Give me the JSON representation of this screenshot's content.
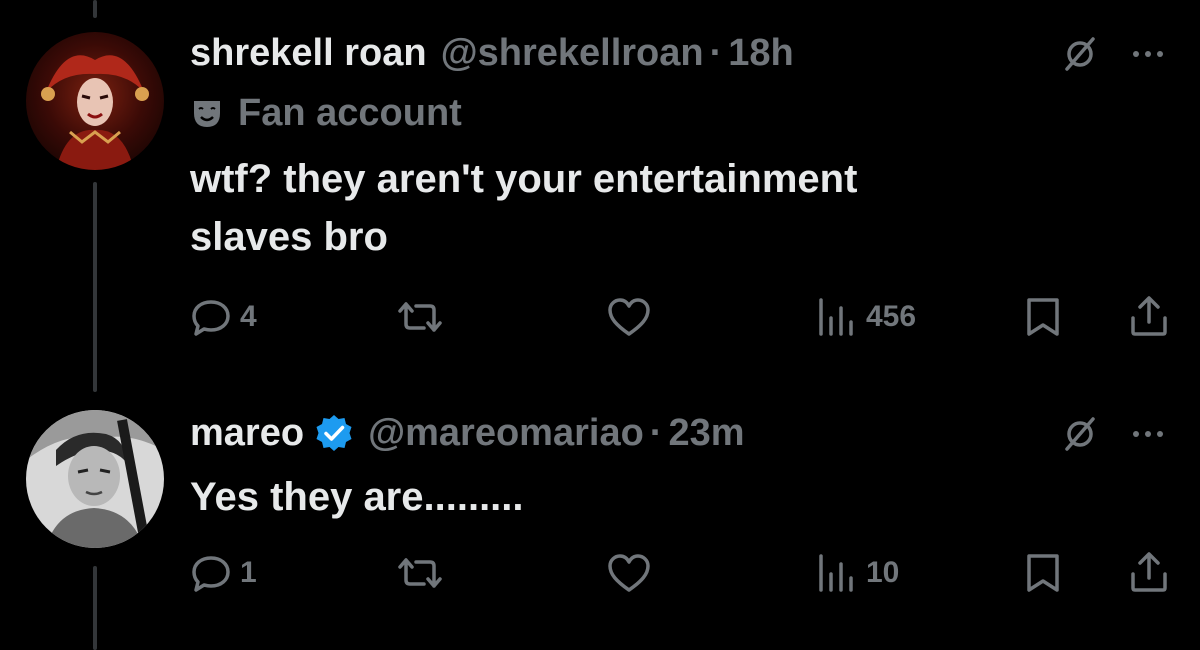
{
  "colors": {
    "background": "#000000",
    "primary_text": "#e7e9ea",
    "secondary_text": "#71767b",
    "thread_line": "#333639",
    "verified_badge": "#1d9bf0"
  },
  "tweets": [
    {
      "display_name": "shrekell roan",
      "handle": "@shrekellroan",
      "separator": "·",
      "time": "18h",
      "label": "Fan account",
      "label_icon": "theater-masks-icon",
      "verified": false,
      "text": "wtf? they aren't your entertainment\nslaves bro",
      "actions": {
        "replies": "4",
        "reposts": "",
        "likes": "",
        "views": "456"
      }
    },
    {
      "display_name": "mareo",
      "handle": "@mareomariao",
      "separator": "·",
      "time": "23m",
      "verified": true,
      "text": "Yes they are.........",
      "actions": {
        "replies": "1",
        "reposts": "",
        "likes": "",
        "views": "10"
      }
    }
  ],
  "icons": [
    "grok-icon",
    "more-icon",
    "reply-icon",
    "repost-icon",
    "like-icon",
    "views-icon",
    "bookmark-icon",
    "share-icon",
    "verified-badge-icon"
  ]
}
